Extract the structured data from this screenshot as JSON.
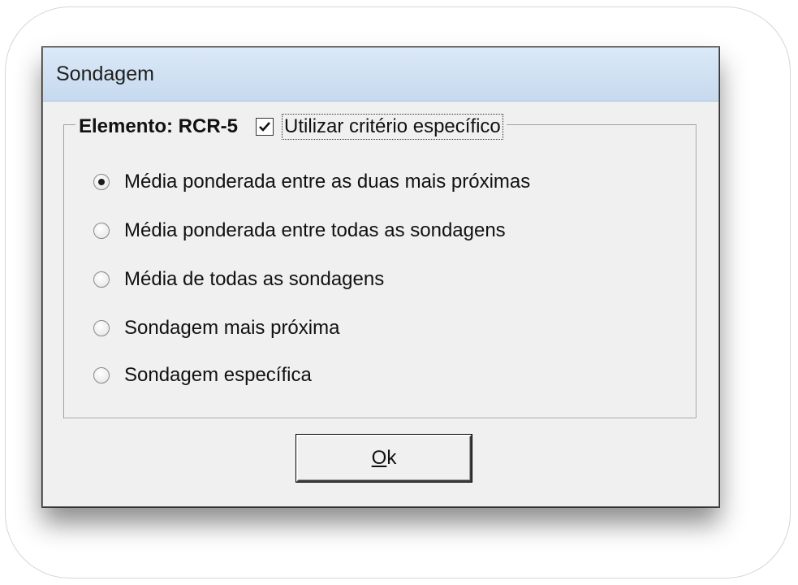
{
  "window": {
    "title": "Sondagem"
  },
  "group": {
    "label": "Elemento: RCR-5",
    "checkbox_label": "Utilizar critério específico",
    "checkbox_checked": true
  },
  "options": [
    {
      "label": "Média ponderada entre as duas mais próximas",
      "selected": true
    },
    {
      "label": "Média ponderada entre todas as sondagens",
      "selected": false
    },
    {
      "label": "Média de todas as sondagens",
      "selected": false
    },
    {
      "label": "Sondagem mais próxima",
      "selected": false
    },
    {
      "label": "Sondagem específica",
      "selected": false
    }
  ],
  "buttons": {
    "ok_mnemonic": "O",
    "ok_rest": "k"
  }
}
